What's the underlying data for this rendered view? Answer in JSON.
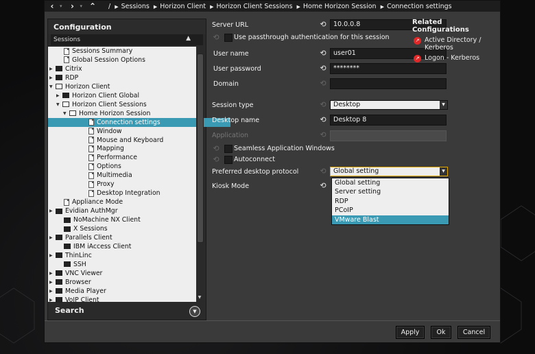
{
  "nav": {
    "back_icon": "chevron-left-icon",
    "forward_icon": "chevron-right-icon",
    "up_icon": "chevron-up-icon",
    "root_sep": "/",
    "breadcrumbs": [
      "Sessions",
      "Horizon Client",
      "Horizon Client Sessions",
      "Home Horizon Session",
      "Connection settings"
    ]
  },
  "left": {
    "title": "Configuration",
    "section_dropdown": "Sessions",
    "tree": [
      {
        "label": "Sessions Summary",
        "icon": "doc",
        "toggle": ""
      },
      {
        "label": "Global Session Options",
        "icon": "doc",
        "toggle": ""
      },
      {
        "label": "Citrix",
        "icon": "folder-filled",
        "toggle": "▶"
      },
      {
        "label": "RDP",
        "icon": "folder-filled",
        "toggle": "▶"
      },
      {
        "label": "Horizon Client",
        "icon": "folder",
        "toggle": "▼"
      },
      {
        "label": "Horizon Client Global",
        "icon": "folder-filled",
        "toggle": "▶"
      },
      {
        "label": "Horizon Client Sessions",
        "icon": "folder",
        "toggle": "▼"
      },
      {
        "label": "Home Horizon Session",
        "icon": "folder",
        "toggle": "▼"
      },
      {
        "label": "Connection settings",
        "icon": "doc",
        "toggle": ""
      },
      {
        "label": "Window",
        "icon": "doc",
        "toggle": ""
      },
      {
        "label": "Mouse and Keyboard",
        "icon": "doc",
        "toggle": ""
      },
      {
        "label": "Mapping",
        "icon": "doc",
        "toggle": ""
      },
      {
        "label": "Performance",
        "icon": "doc",
        "toggle": ""
      },
      {
        "label": "Options",
        "icon": "doc",
        "toggle": ""
      },
      {
        "label": "Multimedia",
        "icon": "doc",
        "toggle": ""
      },
      {
        "label": "Proxy",
        "icon": "doc",
        "toggle": ""
      },
      {
        "label": "Desktop Integration",
        "icon": "doc",
        "toggle": ""
      },
      {
        "label": "Appliance Mode",
        "icon": "doc",
        "toggle": ""
      },
      {
        "label": "Evidian AuthMgr",
        "icon": "folder-filled",
        "toggle": "▶"
      },
      {
        "label": "NoMachine NX Client",
        "icon": "folder-filled",
        "toggle": ""
      },
      {
        "label": "X Sessions",
        "icon": "folder-filled",
        "toggle": ""
      },
      {
        "label": "Parallels Client",
        "icon": "folder-filled",
        "toggle": "▶"
      },
      {
        "label": "IBM iAccess Client",
        "icon": "folder-filled",
        "toggle": ""
      },
      {
        "label": "ThinLinc",
        "icon": "folder-filled",
        "toggle": "▶"
      },
      {
        "label": "SSH",
        "icon": "folder-filled",
        "toggle": ""
      },
      {
        "label": "VNC Viewer",
        "icon": "folder-filled",
        "toggle": "▶"
      },
      {
        "label": "Browser",
        "icon": "folder-filled",
        "toggle": "▶"
      },
      {
        "label": "Media Player",
        "icon": "folder-filled",
        "toggle": "▶"
      },
      {
        "label": "VoIP Client",
        "icon": "folder-filled",
        "toggle": "▶"
      }
    ],
    "search_label": "Search"
  },
  "form": {
    "server_url_label": "Server URL",
    "server_url_value": "10.0.0.8",
    "passthrough_label": "Use passthrough authentication for this session",
    "username_label": "User name",
    "username_value": "user01",
    "password_label": "User password",
    "password_value": "********",
    "domain_label": "Domain",
    "domain_value": "",
    "session_type_label": "Session type",
    "session_type_value": "Desktop",
    "desktop_name_label": "Desktop name",
    "desktop_name_value": "Desktop 8",
    "application_label": "Application",
    "seamless_label": "Seamless Application Windows",
    "autoconnect_label": "Autoconnect",
    "protocol_label": "Preferred desktop protocol",
    "protocol_value": "Global setting",
    "protocol_options": [
      "Global setting",
      "Server setting",
      "RDP",
      "PCoIP",
      "VMware Blast"
    ],
    "kiosk_label": "Kiosk Mode"
  },
  "related": {
    "title": "Related Configurations",
    "items": [
      "Active Directory / Kerberos",
      "Logon - Kerberos"
    ]
  },
  "buttons": {
    "apply": "Apply",
    "ok": "Ok",
    "cancel": "Cancel"
  },
  "colors": {
    "selection": "#3a9ab3",
    "focus": "#e0a800",
    "related_icon": "#e02828"
  }
}
